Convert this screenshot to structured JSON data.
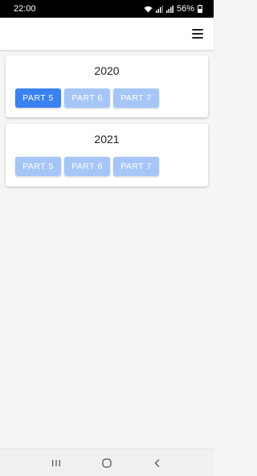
{
  "status_bar": {
    "time": "22:00",
    "battery": "56%",
    "icons": [
      "wifi-icon",
      "signal-icon",
      "signal-icon",
      "battery-icon"
    ]
  },
  "app_bar": {
    "menu_icon": "hamburger-menu-icon"
  },
  "cards": [
    {
      "year": "2020",
      "parts": [
        {
          "label": "PART 5",
          "state": "active"
        },
        {
          "label": "PART 6",
          "state": "inactive"
        },
        {
          "label": "PART 7",
          "state": "inactive"
        }
      ]
    },
    {
      "year": "2021",
      "parts": [
        {
          "label": "PART 5",
          "state": "inactive"
        },
        {
          "label": "PART 6",
          "state": "inactive"
        },
        {
          "label": "PART 7",
          "state": "inactive"
        }
      ]
    }
  ],
  "nav_bar": {
    "icons": [
      "recents-icon",
      "home-icon",
      "back-icon"
    ]
  },
  "colors": {
    "button_active": "#3a82ef",
    "button_inactive": "#a6c6f8"
  }
}
